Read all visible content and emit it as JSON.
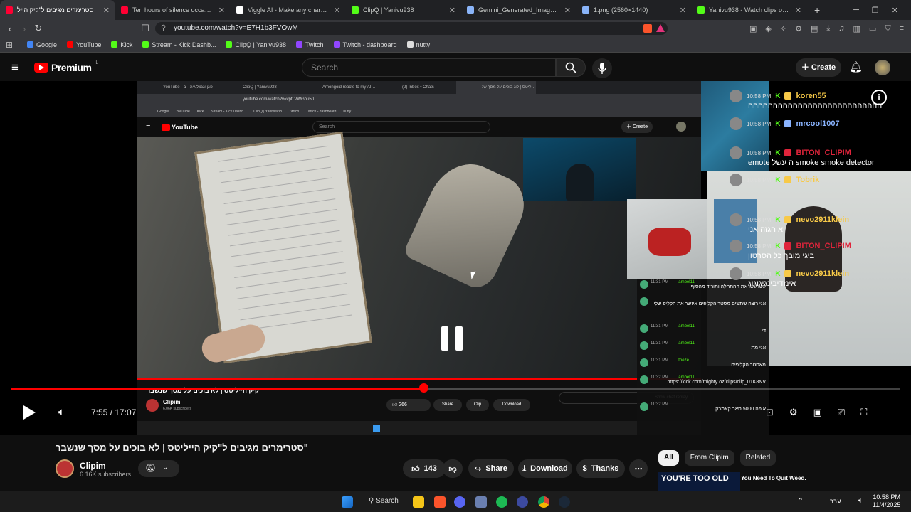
{
  "browser": {
    "tabs": [
      {
        "title": "סטרימרים מגיבים ל\"קיק הייל",
        "color": "#ff0033",
        "active": true
      },
      {
        "title": "Ten hours of silence occasionally bro",
        "color": "#ff0033"
      },
      {
        "title": "Viggle AI - Make any character move",
        "color": "#ffffff"
      },
      {
        "title": "ClipQ | Yanivu938",
        "color": "#53fc18"
      },
      {
        "title": "Gemini_Generated_Image_cesxvxces",
        "color": "#8ab4f8"
      },
      {
        "title": "1.png (2560×1440)",
        "color": "#8ab4f8"
      },
      {
        "title": "Yanivu938 - Watch clips on Kick",
        "color": "#53fc18"
      }
    ],
    "url": "youtube.com/watch?v=E7H1b3FVOwM",
    "bookmarks": [
      {
        "label": "Google",
        "color": "#4285f4"
      },
      {
        "label": "YouTube",
        "color": "#ff0000"
      },
      {
        "label": "Kick",
        "color": "#53fc18"
      },
      {
        "label": "Stream - Kick Dashb...",
        "color": "#53fc18"
      },
      {
        "label": "ClipQ | Yanivu938",
        "color": "#53fc18"
      },
      {
        "label": "Twitch",
        "color": "#9146ff"
      },
      {
        "label": "Twitch - dashboard",
        "color": "#9146ff"
      },
      {
        "label": "nutty",
        "color": "#dddddd"
      }
    ]
  },
  "youtube": {
    "logo": "Premium",
    "region": "IL",
    "search_placeholder": "Search",
    "create_label": "Create"
  },
  "inner": {
    "tabs": [
      "YouTube - כאן אמולוגיה - ב",
      "ClipQ | Yanivu938",
      "Amongoid reacts to my AI Song - Yo",
      "(2) Inbox • Chats",
      "קיק הייליטס | לא בוכים על מסך שנ"
    ],
    "url": "youtube.com/watch?v=vpfLVWGou50",
    "bookmarks": [
      "Google",
      "YouTube",
      "Kick",
      "Stream - Kick Dashb...",
      "ClipQ | Yanivu938",
      "Twitch",
      "Twitch - dashboard",
      "nutty"
    ],
    "search": "Search",
    "create": "Create",
    "logo": "YouTube",
    "video_title": "קיק הייליטס | לא בוכים על מסך שנשבר",
    "channel": "Clipim",
    "subs": "6.06K subscribers",
    "likes": "266",
    "share": "Share",
    "clip": "Clip",
    "download": "Download",
    "chat_replay": "Show chat replay"
  },
  "chat_a": [
    {
      "time": "11:31 PM",
      "user": "ambel11",
      "msg": "עשו עשו את ההתחלה ותוריד מהסוף"
    },
    {
      "time": "",
      "user": "",
      "msg": "אני רוצה שתשים מסטר הקליפים איזשר את הקליפ שלי"
    },
    {
      "time": "11:31 PM",
      "user": "ambel11",
      "msg": "די"
    },
    {
      "time": "11:31 PM",
      "user": "ambel11",
      "msg": "אני מת"
    },
    {
      "time": "11:31 PM",
      "user": "theze",
      "msg": "מאסטר הקליפים"
    },
    {
      "time": "11:32 PM",
      "user": "ambel11",
      "msg": "https://kick.com/mighty oz/clips/clip_01K8NV"
    },
    {
      "time": "11:32 PM",
      "user": "",
      "msg": "איפה 5000 סאב קאמבק"
    }
  ],
  "chat_b": [
    {
      "time": "10:58 PM",
      "user": "koren55",
      "color": "#f7c948",
      "msg": "ההההההההההההההההההההההההההה"
    },
    {
      "time": "10:58 PM",
      "user": "mrcool1007",
      "color": "#8ab4ff",
      "msg": ""
    },
    {
      "time": "10:58 PM",
      "user": "BITON_CLIPIM",
      "color": "#e0243b",
      "msg": "emote ה עשל smoke smoke detector"
    },
    {
      "time": "10:58 PM",
      "user": "Tobrik",
      "color": "#f7c948",
      "msg": ""
    },
    {
      "time": "10:58 PM",
      "user": "nevo2911klein",
      "color": "#f7c948",
      "msg": "יא הגזה אני"
    },
    {
      "time": "10:58 PM",
      "user": "BITON_CLIPIM",
      "color": "#e0243b",
      "msg": "ביגי מובך כל הסרטון"
    },
    {
      "time": "10:58 PM",
      "user": "nevo2911klein",
      "color": "#f7c948",
      "msg": "אינזדיבינגיגוגוג"
    }
  ],
  "player": {
    "time": "7:55 / 17:07",
    "progress": 0.464
  },
  "video": {
    "title": "סטרימרים מגיבים ל\"קיק הייליטס | לא בוכים על מסך שנשבר\"",
    "channel": "Clipim",
    "subs": "6.16K subscribers",
    "likes": "143",
    "share": "Share",
    "download": "Download",
    "thanks": "Thanks"
  },
  "filters": [
    "All",
    "From Clipim",
    "Related"
  ],
  "ad_text": {
    "big": "YOU'RE TOO OLD",
    "small": "You Need To Quit Weed."
  },
  "taskbar": {
    "search": "Search",
    "lang": "עבר",
    "time": "10:58 PM",
    "date": "11/4/2025"
  }
}
